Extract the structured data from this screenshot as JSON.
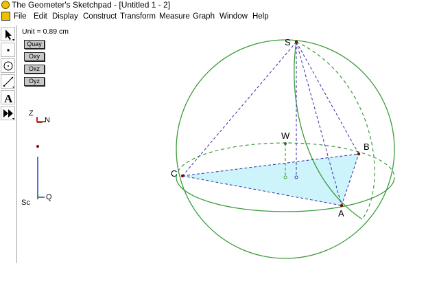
{
  "window": {
    "title": "The Geometer's Sketchpad - [Untitled 1 - 2]"
  },
  "menu": [
    "File",
    "Edit",
    "Display",
    "Construct",
    "Transform",
    "Measure",
    "Graph",
    "Window",
    "Help"
  ],
  "tools": [
    {
      "name": "arrow-select-tool",
      "icon": "arrow"
    },
    {
      "name": "point-tool",
      "icon": "point"
    },
    {
      "name": "compass-tool",
      "icon": "circle"
    },
    {
      "name": "straightedge-tool",
      "icon": "segment"
    },
    {
      "name": "text-tool",
      "icon": "A"
    },
    {
      "name": "custom-tool",
      "icon": "double-arrow"
    }
  ],
  "unit_label": "Unit = 0.89 cm",
  "view_buttons": [
    "Quay",
    "Oxy",
    "Oxz",
    "Oyz"
  ],
  "axis_labels": {
    "z": "Z",
    "n": "N",
    "sc": "Sc",
    "q": "Q"
  },
  "points": {
    "S": "S",
    "W": "W",
    "B": "B",
    "C": "C",
    "A": "A"
  },
  "colors": {
    "sphere": "#3b9a3b",
    "dashed": "#2e2ea8",
    "triangle_fill": "#ccf4fa",
    "axis_red": "#d12020",
    "axis_green": "#2aa02a",
    "axis_blue": "#2040d0"
  }
}
